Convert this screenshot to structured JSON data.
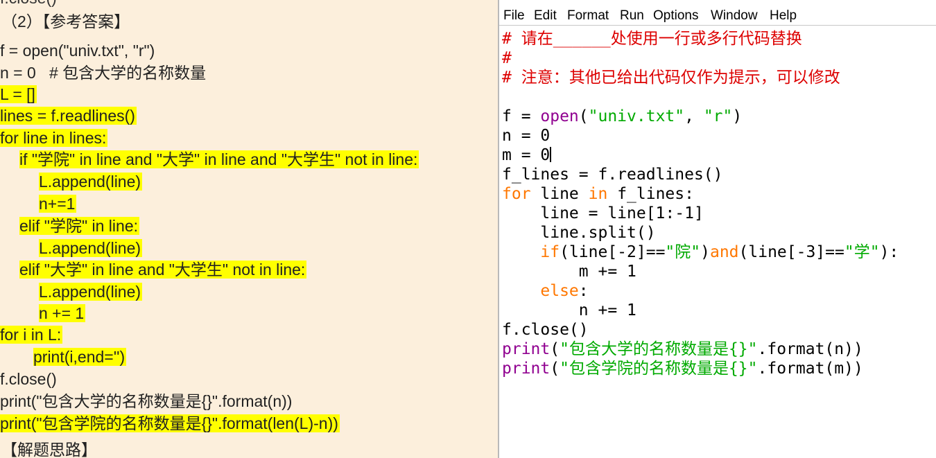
{
  "left_doc": {
    "cut_top_text": "f.close()",
    "heading": "（2）【参考答案】",
    "code_lines": [
      "f = open(\"univ.txt\", \"r\")",
      "n = 0   # 包含大学的名称数量",
      "L = []",
      "lines = f.readlines()",
      "for line in lines:",
      "if \"学院\" in line and \"大学\" in line and \"大学生\" not in line:",
      "L.append(line)",
      "n+=1",
      "elif \"学院\" in line:",
      "L.append(line)",
      "elif \"大学\" in line and \"大学生\" not in line:",
      "L.append(line)",
      "n += 1",
      "for i in L:",
      "print(i,end='')",
      "f.close()",
      "print(\"包含大学的名称数量是{}\".format(n))",
      "print(\"包含学院的名称数量是{}\".format(len(L)-n))"
    ],
    "footer": "【解题思路】",
    "highlight_color": "#ffff00"
  },
  "editor": {
    "menu": [
      "File",
      "Edit",
      "Format",
      "Run",
      "Options",
      "Window",
      "Help"
    ],
    "comments": [
      "# 请在______处使用一行或多行代码替换",
      "#",
      "# 注意：其他已给出代码仅作为提示，可以修改"
    ],
    "t": {
      "open_fn": "open",
      "univ_str": "\"univ.txt\"",
      "r_str": "\"r\"",
      "yuan_str": "\"院\"",
      "xue_str": "\"学\"",
      "print_fn": "print",
      "msg1": "\"包含大学的名称数量是{}\"",
      "msg2": "\"包含学院的名称数量是{}\""
    },
    "colors": {
      "comment": "#dd0000",
      "string": "#00aa00",
      "keyword": "#ff7700",
      "builtin": "#900090"
    }
  }
}
